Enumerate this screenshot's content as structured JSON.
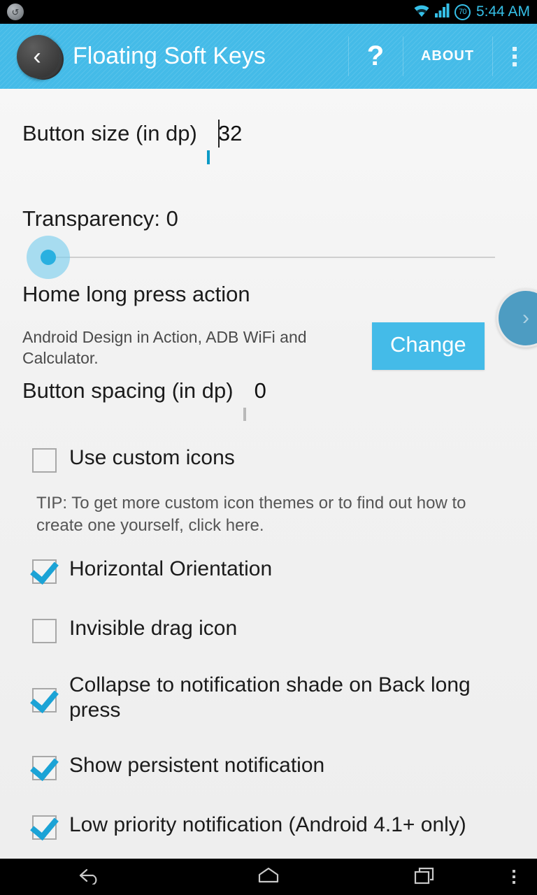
{
  "status_bar": {
    "notification_icon": "sync-icon",
    "wifi_icon": "wifi-icon",
    "signal_icon": "signal-bars-icon",
    "battery_level": "70",
    "time": "5:44 AM",
    "accent_color": "#36c0e8"
  },
  "action_bar": {
    "up_icon": "back-chevron-icon",
    "title": "Floating Soft Keys",
    "help_label": "?",
    "about_label": "ABOUT",
    "overflow_icon": "overflow-menu-icon",
    "background_color": "#44bbe8"
  },
  "settings": {
    "button_size": {
      "label": "Button size (in dp)",
      "value": "32",
      "focused": true
    },
    "transparency": {
      "label": "Transparency: 0",
      "value": 0,
      "min": 0,
      "max": 100
    },
    "home_long_press": {
      "title": "Home long press action",
      "description": "Android Design in Action, ADB WiFi and Calculator.",
      "change_label": "Change"
    },
    "button_spacing": {
      "label": "Button spacing (in dp)",
      "value": "0",
      "focused": false
    },
    "tip": "TIP: To get more custom icon themes or to find out how to create one yourself, click here.",
    "checkboxes": [
      {
        "label": "Use custom icons",
        "checked": false
      },
      {
        "label": "Horizontal Orientation",
        "checked": true
      },
      {
        "label": "Invisible drag icon",
        "checked": false
      },
      {
        "label": "Collapse to notification shade on Back long press",
        "checked": true
      },
      {
        "label": "Show persistent notification",
        "checked": true
      },
      {
        "label": "Low priority notification (Android 4.1+ only)",
        "checked": true
      }
    ]
  },
  "edge_tab": {
    "icon": "chevron-right-icon",
    "label": "›",
    "color": "#4d9cc2"
  },
  "nav_bar": {
    "back_icon": "nav-back-icon",
    "home_icon": "nav-home-icon",
    "recents_icon": "nav-recents-icon",
    "menu_icon": "nav-menu-icon"
  }
}
